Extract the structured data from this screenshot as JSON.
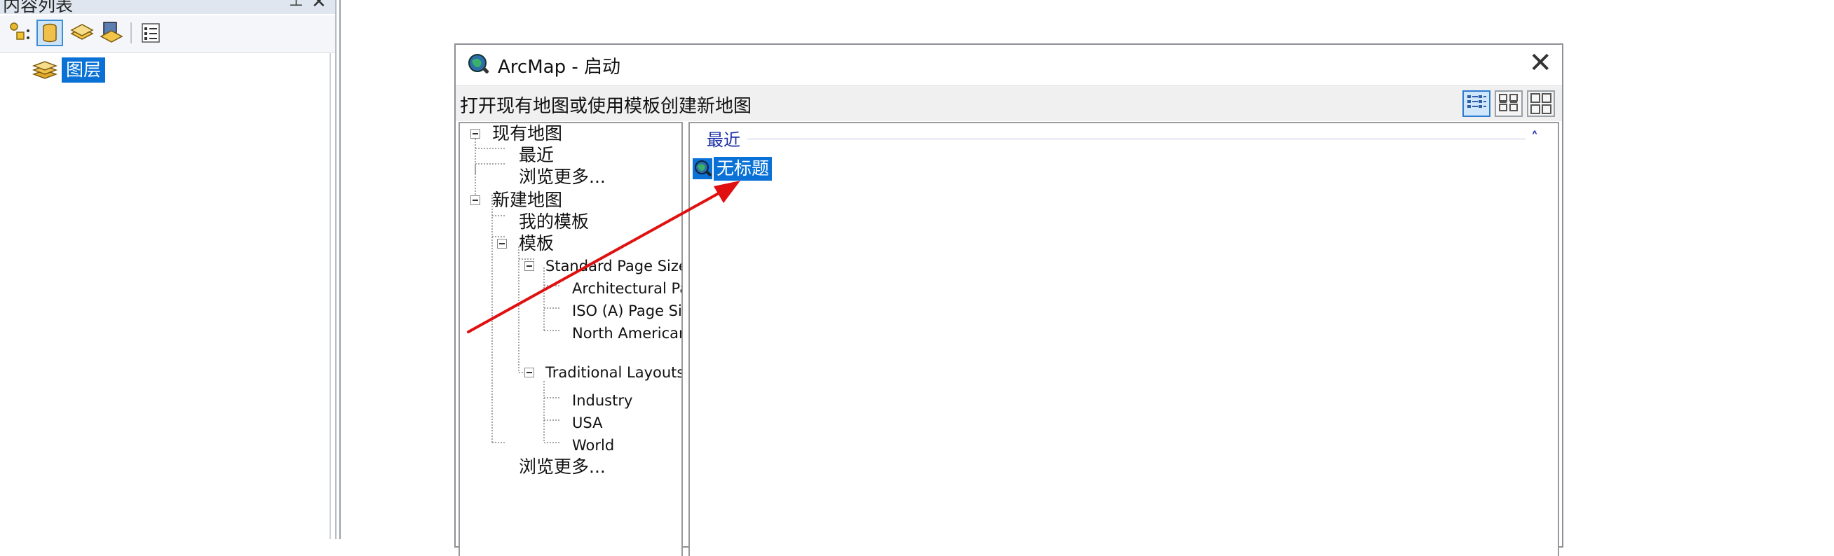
{
  "toc_panel": {
    "title": "内容列表",
    "pin_glyph": "⊥",
    "close_glyph": "✕",
    "toolbar": [
      "list-by-drawing-order",
      "list-by-source",
      "list-by-visibility",
      "list-by-selection",
      "options"
    ],
    "layer_root": "图层"
  },
  "dialog": {
    "title": "ArcMap - 启动",
    "close_glyph": "✕",
    "instruction": "打开现有地图或使用模板创建新地图",
    "view_buttons": [
      "details-view",
      "large-icons-view",
      "thumbnails-view"
    ],
    "nav_tree": {
      "existing_maps": "现有地图",
      "recent": "最近",
      "browse_more_1": "浏览更多...",
      "new_maps": "新建地图",
      "my_templates": "我的模板",
      "templates": "模板",
      "standard_page_sizes": "Standard Page Sizes",
      "architectural": "Architectural Pag",
      "iso": "ISO (A) Page Siz",
      "north_american": "North American (",
      "traditional_layouts": "Traditional Layouts",
      "industry": "Industry",
      "usa": "USA",
      "world": "World",
      "browse_more_2": "浏览更多..."
    },
    "content": {
      "section_label": "最近",
      "collapse_glyph": "˄",
      "item_label": "无标题"
    }
  },
  "colors": {
    "selection": "#0a72d6",
    "annotation_arrow": "#e01010",
    "section_text": "#1a2fa8"
  }
}
